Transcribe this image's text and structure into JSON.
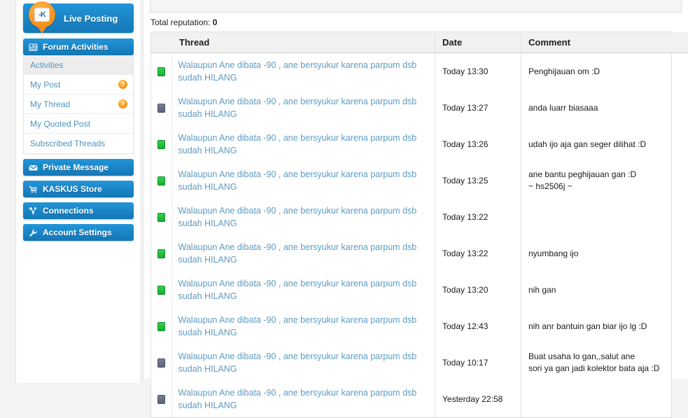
{
  "sidebar": {
    "live_posting": {
      "label": "Live Posting",
      "badge_text": "-K"
    },
    "blocks": [
      {
        "icon": "calendar-icon",
        "label": "Forum Activities",
        "items": [
          {
            "label": "Activities",
            "active": true,
            "help": false
          },
          {
            "label": "My Post",
            "active": false,
            "help": true
          },
          {
            "label": "My Thread",
            "active": false,
            "help": true
          },
          {
            "label": "My Quoted Post",
            "active": false,
            "help": false
          },
          {
            "label": "Subscribed Threads",
            "active": false,
            "help": false
          }
        ]
      },
      {
        "icon": "envelope-icon",
        "label": "Private Message",
        "items": []
      },
      {
        "icon": "cart-icon",
        "label": "KASKUS Store",
        "items": []
      },
      {
        "icon": "network-icon",
        "label": "Connections",
        "items": []
      },
      {
        "icon": "wrench-icon",
        "label": "Account Settings",
        "items": []
      }
    ],
    "help_glyph": "?"
  },
  "main": {
    "total_reputation_label": "Total reputation:",
    "total_reputation_value": "0",
    "columns": {
      "thread": "Thread",
      "date": "Date",
      "comment": "Comment"
    },
    "rows": [
      {
        "status": "green",
        "thread": "Walaupun Ane dibata -90 , ane bersyukur karena parpum dsb sudah HILANG",
        "date": "Today 13:30",
        "comment": [
          "Penghijauan om :D"
        ]
      },
      {
        "status": "gray",
        "thread": "Walaupun Ane dibata -90 , ane bersyukur karena parpum dsb sudah HILANG",
        "date": "Today 13:27",
        "comment": [
          "anda luarr biasaaa"
        ]
      },
      {
        "status": "green",
        "thread": "Walaupun Ane dibata -90 , ane bersyukur karena parpum dsb sudah HILANG",
        "date": "Today 13:26",
        "comment": [
          "udah ijo aja gan seger dilihat :D"
        ]
      },
      {
        "status": "green",
        "thread": "Walaupun Ane dibata -90 , ane bersyukur karena parpum dsb sudah HILANG",
        "date": "Today 13:25",
        "comment": [
          "ane bantu peghijauan gan :D",
          "~ hs2506j ~"
        ]
      },
      {
        "status": "green",
        "thread": "Walaupun Ane dibata -90 , ane bersyukur karena parpum dsb sudah HILANG",
        "date": "Today 13:22",
        "comment": []
      },
      {
        "status": "green",
        "thread": "Walaupun Ane dibata -90 , ane bersyukur karena parpum dsb sudah HILANG",
        "date": "Today 13:22",
        "comment": [
          "nyumbang ijo"
        ]
      },
      {
        "status": "green",
        "thread": "Walaupun Ane dibata -90 , ane bersyukur karena parpum dsb sudah HILANG",
        "date": "Today 13:20",
        "comment": [
          "nih gan"
        ]
      },
      {
        "status": "green",
        "thread": "Walaupun Ane dibata -90 , ane bersyukur karena parpum dsb sudah HILANG",
        "date": "Today 12:43",
        "comment": [
          "nih anr bantuin gan biar ijo lg :D"
        ]
      },
      {
        "status": "gray",
        "thread": "Walaupun Ane dibata -90 , ane bersyukur karena parpum dsb sudah HILANG",
        "date": "Today 10:17",
        "comment": [
          "Buat usaha lo gan,,salut ane",
          "sori ya gan jadi kolektor bata aja :D"
        ]
      },
      {
        "status": "gray",
        "thread": "Walaupun Ane dibata -90 , ane bersyukur karena parpum dsb sudah HILANG",
        "date": "Yesterday 22:58",
        "comment": []
      }
    ]
  },
  "colors": {
    "brand_blue": "#1b85c6",
    "accent_orange": "#f6971d",
    "link_blue": "#5c9cc4",
    "status_green": "#18ae32",
    "status_gray": "#5c6379"
  }
}
